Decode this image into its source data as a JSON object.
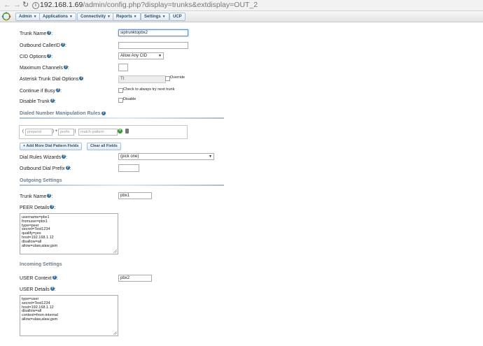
{
  "browser": {
    "url_host": "192.168.1.69",
    "url_path": "/admin/config.php?display=trunks&extdisplay=OUT_2"
  },
  "menu": [
    {
      "label": "Admin",
      "has_caret": true
    },
    {
      "label": "Applications",
      "has_caret": true
    },
    {
      "label": "Connectivity",
      "has_caret": true
    },
    {
      "label": "Reports",
      "has_caret": true
    },
    {
      "label": "Settings",
      "has_caret": true
    },
    {
      "label": "UCP",
      "has_caret": false
    }
  ],
  "form": {
    "trunk_name_label": "Trunk Name",
    "trunk_name_value": "siptrunktopbx2",
    "outbound_callerid_label": "Outbound CallerID",
    "outbound_callerid_value": "",
    "cid_options_label": "CID Options",
    "cid_options_value": "Allow Any CID",
    "max_channels_label": "Maximum Channels",
    "max_channels_value": "",
    "dial_options_label": "Asterisk Trunk Dial Options",
    "dial_options_value": "Tt",
    "override_label": "Override",
    "continue_busy_label": "Continue if Busy",
    "continue_busy_check": "Check to always try next trunk",
    "disable_trunk_label": "Disable Trunk",
    "disable_check": "Disable"
  },
  "dialed_rules": {
    "title": "Dialed Number Manipulation Rules",
    "prepend_placeholder": "prepend",
    "prefix_placeholder": "prefix",
    "match_placeholder": "match pattern",
    "open_paren": "(",
    "close_paren_plus": ") +",
    "pipe": "|",
    "add_more_button": "+ Add More Dial Pattern Fields",
    "clear_all_button": "Clear all Fields",
    "wizards_label": "Dial Rules Wizards",
    "wizards_value": "(pick one)",
    "outbound_prefix_label": "Outbound Dial Prefix",
    "outbound_prefix_value": ""
  },
  "outgoing": {
    "title": "Outgoing Settings",
    "trunk_name_label": "Trunk Name",
    "trunk_name_value": "pbx1",
    "peer_details_label": "PEER Details",
    "peer_details": [
      "username=pbx1",
      "fromuser=pbx1",
      "type=peer",
      "secret=Test1234",
      "qualify=yes",
      "host=192.168.1.12",
      "disallow=all",
      "allow=ulaw,alaw,gsm"
    ]
  },
  "incoming": {
    "title": "Incoming Settings",
    "user_context_label": "USER Context",
    "user_context_value": "pbx2",
    "user_details_label": "USER Details",
    "user_details": [
      "type=user",
      "secret=Test1234",
      "host=192.168.1.12",
      "disallow=all",
      "context=from-internal",
      "allow=ulaw,alaw,gsm"
    ]
  },
  "colors": {
    "accent": "#2f6ea5",
    "section_text": "#6a7f8f",
    "button_border": "#a9bfd6"
  },
  "icons": [
    "back-arrow-icon",
    "forward-arrow-icon",
    "reload-icon",
    "info-icon",
    "freepbx-logo",
    "help-icon",
    "add-icon",
    "trash-icon"
  ]
}
